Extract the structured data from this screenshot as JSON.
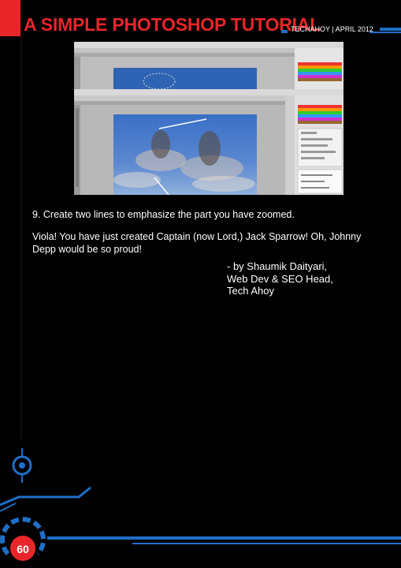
{
  "header": {
    "title": "A SIMPLE PHOTOSHOP TUTORIAL",
    "byline": "TECHAHOY | APRIL 2012"
  },
  "content": {
    "step": "9. Create two lines to emphasize the part you have zoomed.",
    "closing": "Viola! You have just created Captain (now Lord,) Jack Sparrow! Oh, Johnny Depp would be so proud!",
    "credit_lines": [
      "- by Shaumik Daityari,",
      "Web Dev & SEO Head,",
      "Tech Ahoy"
    ]
  },
  "footer": {
    "page_number": "60"
  },
  "colors": {
    "accent_red": "#e8262a",
    "accent_blue": "#1f6fc7"
  }
}
